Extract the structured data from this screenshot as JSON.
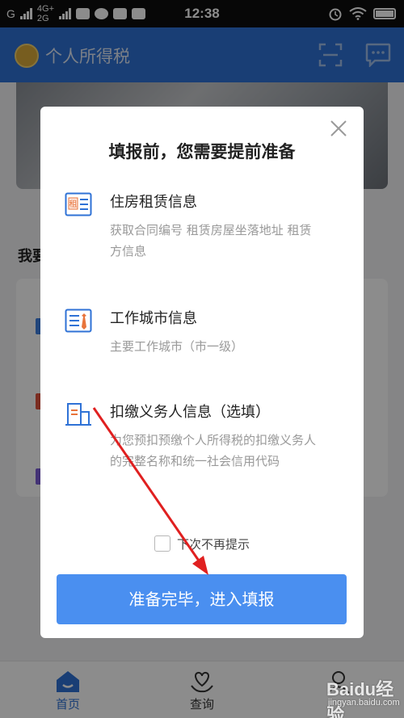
{
  "status_bar": {
    "carrier1": "G",
    "network_top": "4G+",
    "network_bottom": "2G",
    "time": "12:38"
  },
  "app": {
    "title": "个人所得税",
    "icons": {
      "scan": "scan-icon",
      "message": "message-icon"
    },
    "accent_color": "#2f72d6"
  },
  "background": {
    "section_title_peek": "我要"
  },
  "dialog": {
    "title": "填报前，您需要提前准备",
    "items": [
      {
        "title": "住房租赁信息",
        "description": "获取合同编号 租赁房屋坐落地址 租赁方信息",
        "icon": "rent-contract-icon",
        "icon_text": "租"
      },
      {
        "title": "工作城市信息",
        "description": "主要工作城市（市一级）",
        "icon": "work-id-icon"
      },
      {
        "title": "扣缴义务人信息（选填）",
        "description": "为您预扣预缴个人所得税的扣缴义务人的完整名称和统一社会信用代码",
        "icon": "building-icon"
      }
    ],
    "checkbox_label": "下次不再提示",
    "checkbox_checked": false,
    "confirm_label": "准备完毕，进入填报",
    "button_color": "#4a8ff0"
  },
  "bottom_nav": {
    "items": [
      {
        "label": "首页",
        "icon": "home-icon",
        "active": true
      },
      {
        "label": "查询",
        "icon": "heart-hand-icon",
        "active": false
      }
    ]
  },
  "watermark": {
    "logo": "Baidu经验",
    "url": "jingyan.baidu.com"
  }
}
